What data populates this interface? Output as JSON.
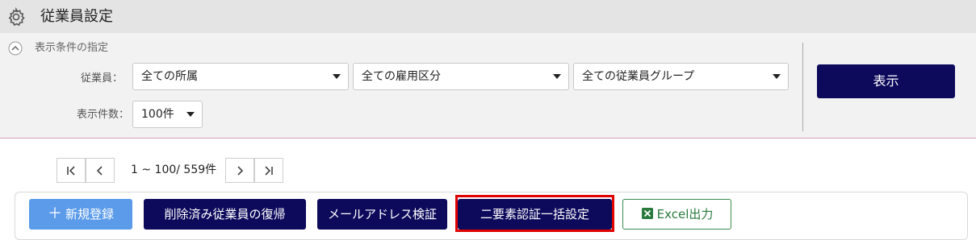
{
  "header": {
    "title": "従業員設定",
    "icon": "gear-icon"
  },
  "filter": {
    "section_label": "表示条件の指定",
    "employee_label": "従業員：",
    "department_select": "全ての所属",
    "employment_select": "全ての雇用区分",
    "group_select": "全ての従業員グループ",
    "count_label": "表示件数：",
    "count_select": "100件",
    "display_button": "表示"
  },
  "pager": {
    "summary": "1 ~ 100/ 559件"
  },
  "actions": {
    "new_register": "新規登録",
    "restore_deleted": "削除済み従業員の復帰",
    "verify_email": "メールアドレス検証",
    "two_factor_bulk": "二要素認証一括設定",
    "excel_export": "Excel出力"
  },
  "colors": {
    "primary": "#0d0a5c",
    "accent": "#5b9bea",
    "highlight": "#e00000",
    "excel": "#2a7a3e"
  }
}
